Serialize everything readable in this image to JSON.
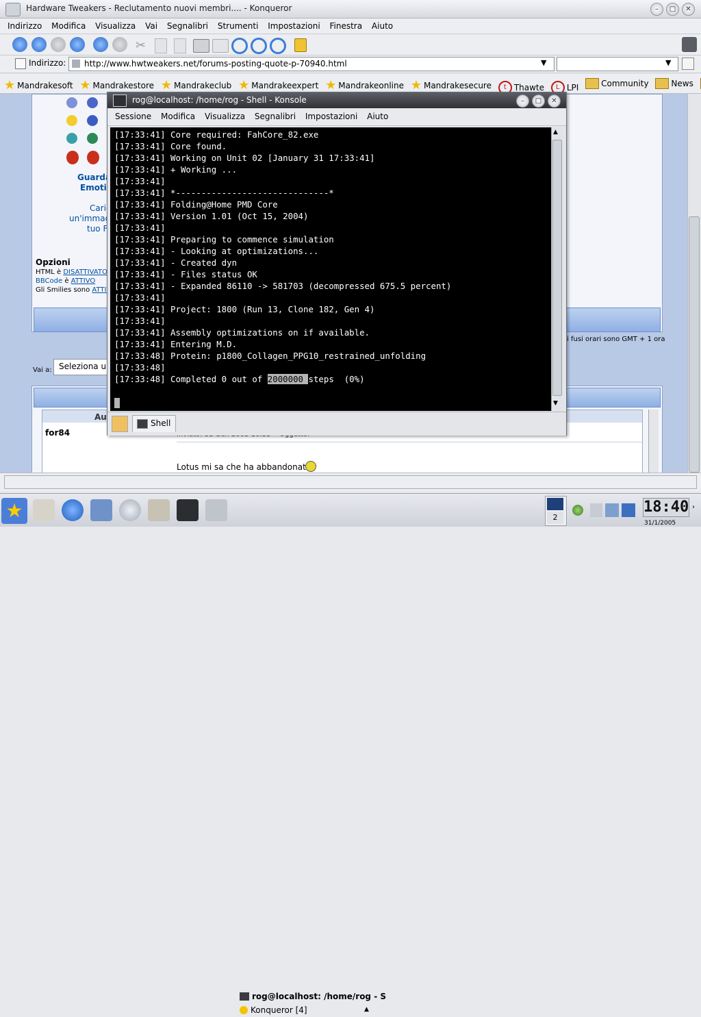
{
  "konqueror": {
    "title": "Hardware Tweakers - Reclutamento nuovi membri.... - Konqueror",
    "menu": [
      "Indirizzo",
      "Modifica",
      "Visualizza",
      "Vai",
      "Segnalibri",
      "Strumenti",
      "Impostazioni",
      "Finestra",
      "Aiuto"
    ],
    "location_label": "Indirizzo:",
    "url": "http://www.hwtweakers.net/forums-posting-quote-p-70940.html",
    "bookmarks": [
      "Mandrakesoft",
      "Mandrakestore",
      "Mandrakeclub",
      "Mandrakeexpert",
      "Mandrakeonline",
      "Mandrakesecure",
      "Thawte",
      "LPI",
      "Community",
      "News"
    ],
    "bookmarks_more": "»"
  },
  "webpage": {
    "emoticons_link1": "Guarda",
    "emoticons_link2": "Emotic",
    "upload_line1": "Caric",
    "upload_line2": "un'immag",
    "upload_line3": "tuo F",
    "options_title": "Opzioni",
    "html_label": "HTML è ",
    "html_value": "DISATTIVATO",
    "bbcode_label": "BBCode",
    "bbcode_mid": " è ",
    "bbcode_value": "ATTIVO",
    "smilies_label": "Gli Smilies sono ",
    "smilies_value": "ATTIVI",
    "timezone_text": "i fusi orari sono GMT + 1 ora",
    "goto_label": "Vai a:",
    "goto_select": "Seleziona un",
    "author_header": "Aut",
    "post_author": "for84",
    "post_meta": "Inviato: 31 Gen 2005 16:33    Oggetto:",
    "post_body": "Lotus mi sa che ha abbandonato"
  },
  "konsole": {
    "title": "rog@localhost: /home/rog - Shell - Konsole",
    "menu": [
      "Sessione",
      "Modifica",
      "Visualizza",
      "Segnalibri",
      "Impostazioni",
      "Aiuto"
    ],
    "lines": [
      "[17:33:41] Core required: FahCore_82.exe",
      "[17:33:41] Core found.",
      "[17:33:41] Working on Unit 02 [January 31 17:33:41]",
      "[17:33:41] + Working ...",
      "[17:33:41]",
      "[17:33:41] *------------------------------*",
      "[17:33:41] Folding@Home PMD Core",
      "[17:33:41] Version 1.01 (Oct 15, 2004)",
      "[17:33:41]",
      "[17:33:41] Preparing to commence simulation",
      "[17:33:41] - Looking at optimizations...",
      "[17:33:41] - Created dyn",
      "[17:33:41] - Files status OK",
      "[17:33:41] - Expanded 86110 -> 581703 (decompressed 675.5 percent)",
      "[17:33:41]",
      "[17:33:41] Project: 1800 (Run 13, Clone 182, Gen 4)",
      "[17:33:41]",
      "[17:33:41] Assembly optimizations on if available.",
      "[17:33:41] Entering M.D.",
      "[17:33:48] Protein: p1800_Collagen_PPG10_restrained_unfolding",
      "[17:33:48]"
    ],
    "last_line_prefix": "[17:33:48] Completed 0 out of ",
    "last_line_selected": "2000000 ",
    "last_line_suffix": "steps  (0%)",
    "tab_label": "Shell"
  },
  "taskbar": {
    "task1": "rog@localhost: /home/rog - S",
    "task2": "Konqueror [4]",
    "desktop_number": "2",
    "clock_time": "18:40",
    "clock_date": "31/1/2005"
  },
  "colors": {
    "konsole_bg": "#000000",
    "konsole_fg": "#ffffff",
    "selection": "#b4b4b4",
    "page_bg": "#b8c9e6",
    "link": "#0050a0"
  }
}
